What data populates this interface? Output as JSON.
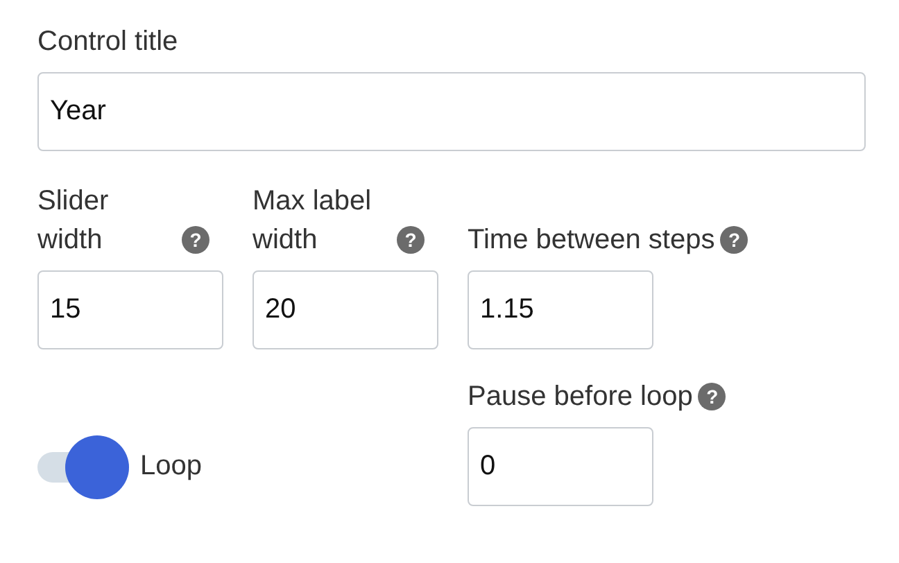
{
  "control_title": {
    "label": "Control title",
    "value": "Year"
  },
  "fields": [
    {
      "label": "Slider width",
      "help": "?",
      "value": "15"
    },
    {
      "label": "Max label width",
      "help": "?",
      "value": "20"
    },
    {
      "label": "Time between steps",
      "help": "?",
      "value": "1.15"
    }
  ],
  "loop": {
    "label": "Loop",
    "on": true
  },
  "pause": {
    "label": "Pause before loop",
    "help": "?",
    "value": "0"
  }
}
